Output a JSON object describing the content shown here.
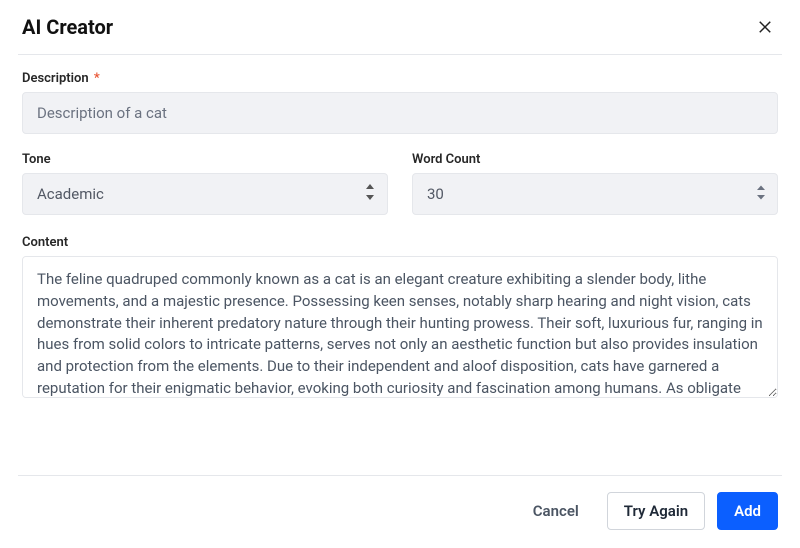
{
  "header": {
    "title": "AI Creator"
  },
  "fields": {
    "description": {
      "label": "Description",
      "required_mark": "*",
      "value": "Description of a cat"
    },
    "tone": {
      "label": "Tone",
      "value": "Academic"
    },
    "word_count": {
      "label": "Word Count",
      "value": "30"
    },
    "content": {
      "label": "Content",
      "value": "The feline quadruped commonly known as a cat is an elegant creature exhibiting a slender body, lithe movements, and a majestic presence. Possessing keen senses, notably sharp hearing and night vision, cats demonstrate their inherent predatory nature through their hunting prowess. Their soft, luxurious fur, ranging in hues from solid colors to intricate patterns, serves not only an aesthetic function but also provides insulation and protection from the elements. Due to their independent and aloof disposition, cats have garnered a reputation for their enigmatic behavior, evoking both curiosity and fascination among humans. As obligate carnivores, they"
    }
  },
  "footer": {
    "cancel": "Cancel",
    "try_again": "Try Again",
    "add": "Add"
  }
}
